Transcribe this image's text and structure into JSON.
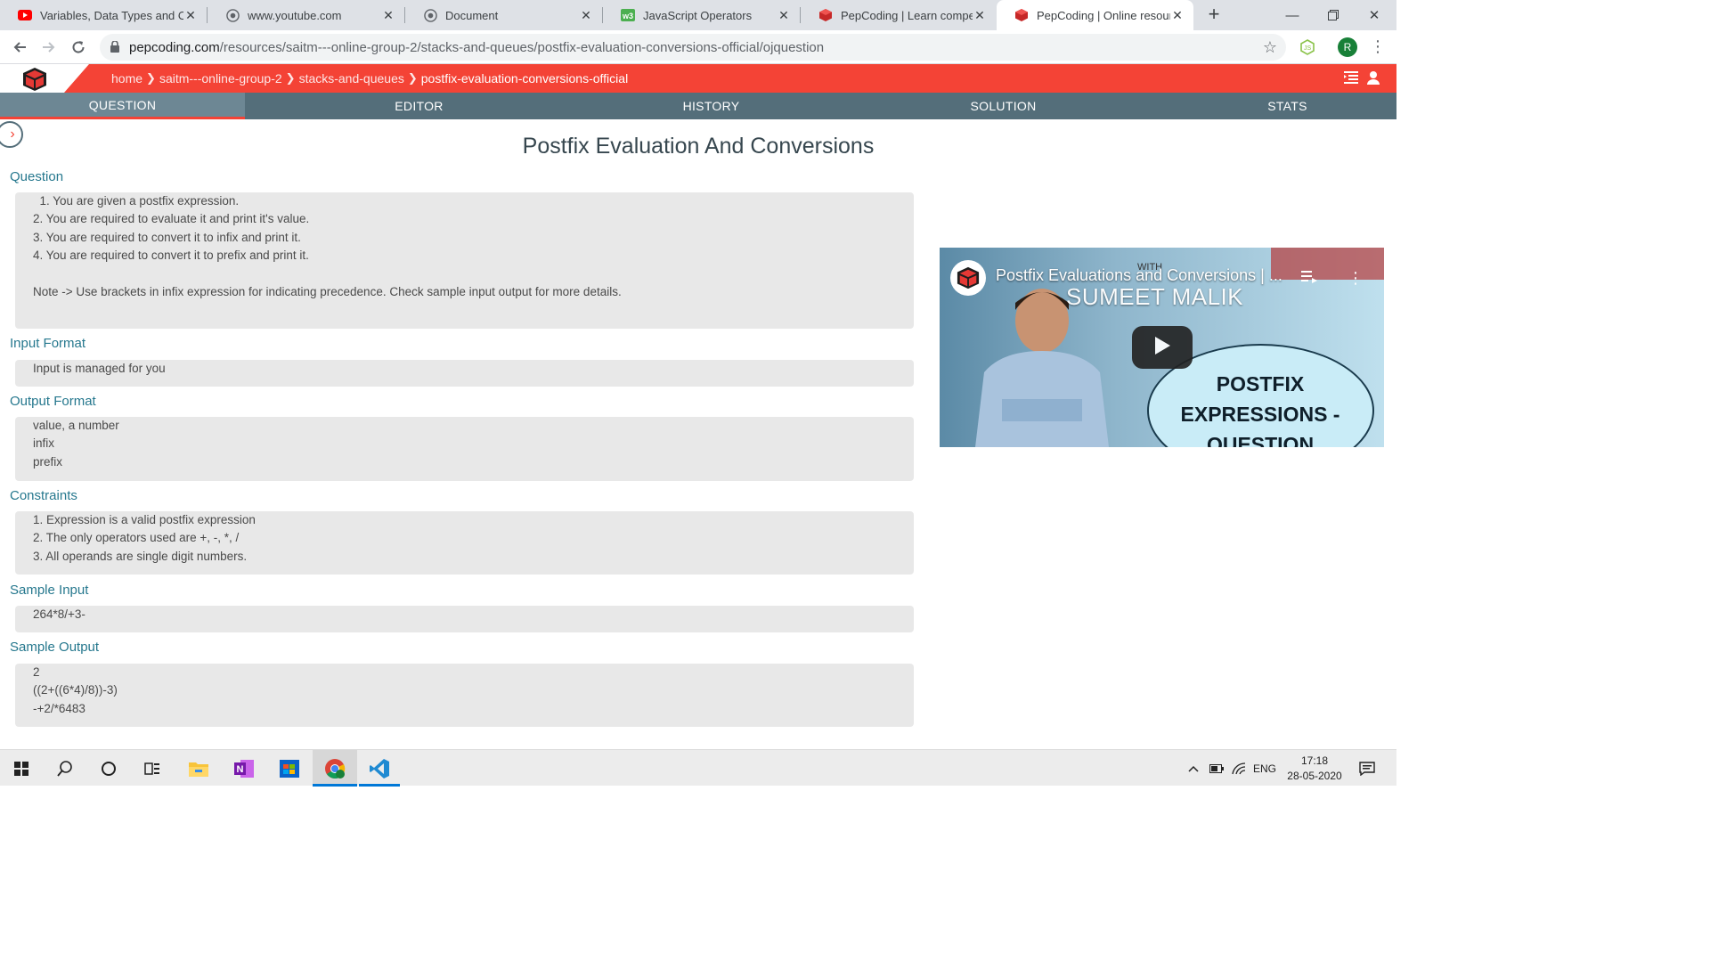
{
  "browser": {
    "tabs": [
      {
        "title": "Variables, Data Types and Op",
        "icon": "youtube-icon"
      },
      {
        "title": "www.youtube.com",
        "icon": "globe-icon"
      },
      {
        "title": "Document",
        "icon": "globe-icon"
      },
      {
        "title": "JavaScript Operators",
        "icon": "w3schools-icon"
      },
      {
        "title": "PepCoding | Learn competiti",
        "icon": "pepcoding-icon"
      },
      {
        "title": "PepCoding | Online resource",
        "icon": "pepcoding-icon",
        "active": true
      }
    ],
    "url_host": "pepcoding.com",
    "url_path": "/resources/saitm---online-group-2/stacks-and-queues/postfix-evaluation-conversions-official/ojquestion",
    "profile_initial": "R"
  },
  "site": {
    "breadcrumbs": [
      "home",
      "saitm---online-group-2",
      "stacks-and-queues",
      "postfix-evaluation-conversions-official"
    ],
    "tabs": [
      "QUESTION",
      "EDITOR",
      "HISTORY",
      "SOLUTION",
      "STATS"
    ],
    "active_tab": "QUESTION",
    "accent_color": "#f44336",
    "nav_color": "#546e7a"
  },
  "question": {
    "title": "Postfix Evaluation And Conversions",
    "sections": {
      "question": {
        "heading": "Question",
        "lines": [
          "  1. You are given a postfix expression.",
          "2. You are required to evaluate it and print it's value.",
          "3. You are required to convert it to infix and print it.",
          "4. You are required to convert it to prefix and print it.",
          "",
          "Note -> Use brackets in infix expression for indicating precedence. Check sample input output for more details."
        ]
      },
      "input_format": {
        "heading": "Input Format",
        "lines": [
          "Input is managed for you"
        ]
      },
      "output_format": {
        "heading": "Output Format",
        "lines": [
          "value, a number",
          "infix",
          "prefix"
        ]
      },
      "constraints": {
        "heading": "Constraints",
        "lines": [
          "1. Expression is a valid postfix expression",
          "2. The only operators used are +, -, *, /",
          "3. All operands are single digit numbers."
        ]
      },
      "sample_input": {
        "heading": "Sample Input",
        "lines": [
          "264*8/+3-"
        ]
      },
      "sample_output": {
        "heading": "Sample Output",
        "lines": [
          "2",
          "((2+((6*4)/8))-3)",
          "-+2/*6483"
        ]
      }
    }
  },
  "video": {
    "title": "Postfix Evaluations and Conversions | ...",
    "with_label": "WITH",
    "presenter": "SUMEET MALIK",
    "thumb_text_1": "POSTFIX",
    "thumb_text_2": "EXPRESSIONS -",
    "thumb_text_3": "QUESTION"
  },
  "taskbar": {
    "language": "ENG",
    "time": "17:18",
    "date": "28-05-2020"
  }
}
